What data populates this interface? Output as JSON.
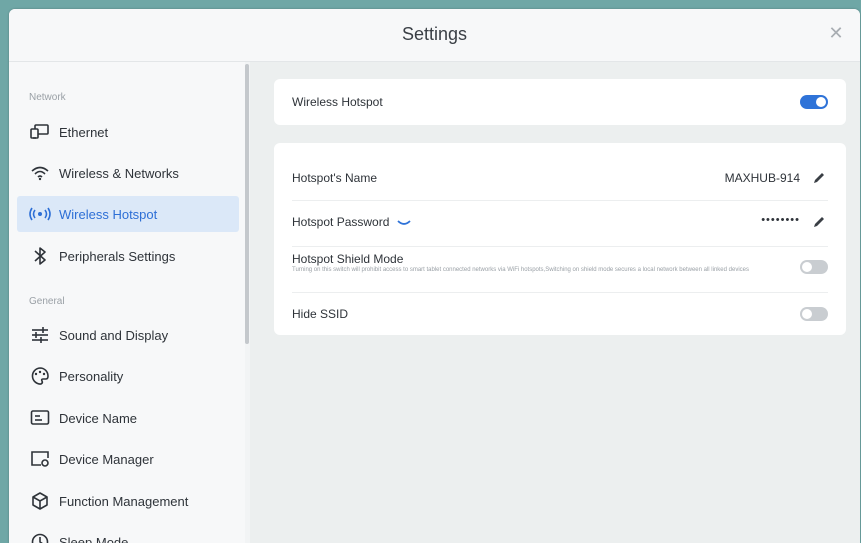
{
  "window": {
    "title": "Settings"
  },
  "sidebar": {
    "sections": [
      {
        "label": "Network"
      },
      {
        "label": "General"
      }
    ],
    "items": [
      {
        "label": "Ethernet",
        "icon": "ethernet-icon",
        "active": false
      },
      {
        "label": "Wireless & Networks",
        "icon": "wifi-icon",
        "active": false
      },
      {
        "label": "Wireless Hotspot",
        "icon": "hotspot-icon",
        "active": true
      },
      {
        "label": "Peripherals Settings",
        "icon": "bluetooth-icon",
        "active": false
      },
      {
        "label": "Sound and Display",
        "icon": "sliders-icon",
        "active": false
      },
      {
        "label": "Personality",
        "icon": "palette-icon",
        "active": false
      },
      {
        "label": "Device Name",
        "icon": "device-name-icon",
        "active": false
      },
      {
        "label": "Device Manager",
        "icon": "device-manager-icon",
        "active": false
      },
      {
        "label": "Function Management",
        "icon": "cube-icon",
        "active": false
      },
      {
        "label": "Sleep Mode",
        "icon": "clock-icon",
        "active": false
      }
    ]
  },
  "hotspot": {
    "toggle_label": "Wireless Hotspot",
    "enabled": true,
    "name_label": "Hotspot's Name",
    "name_value": "MAXHUB-914",
    "password_label": "Hotspot Password",
    "password_value": "••••••••",
    "shield_label": "Hotspot Shield Mode",
    "shield_description": "Turning on this switch will prohibit access to smart tablet connected networks via WiFi hotspots,Switching on shield mode secures a local network between all linked devices",
    "shield_enabled": false,
    "hide_ssid_label": "Hide SSID",
    "hide_ssid_enabled": false
  },
  "colors": {
    "accent": "#2f73d8",
    "active_bg": "#dbe8f8",
    "toggle_off": "#c9cdd1"
  }
}
